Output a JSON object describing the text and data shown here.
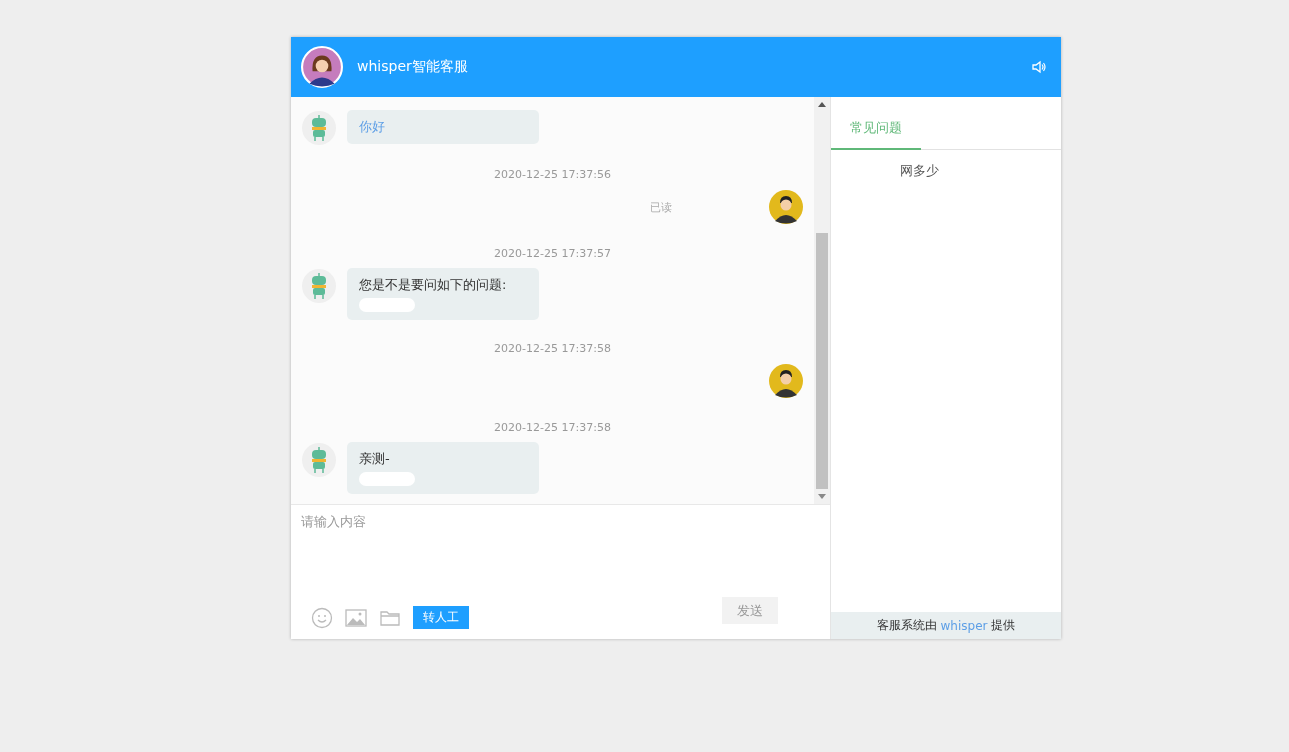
{
  "header": {
    "title": "whisper智能客服"
  },
  "messages": [
    {
      "kind": "bot",
      "text": "你好",
      "link": true
    },
    {
      "kind": "time",
      "text": "2020-12-25 17:37:56"
    },
    {
      "kind": "user",
      "status": "已读"
    },
    {
      "kind": "time",
      "text": "2020-12-25 17:37:57"
    },
    {
      "kind": "bot",
      "text": "您是不是要问如下的问题:",
      "link": false,
      "redacted": true
    },
    {
      "kind": "time",
      "text": "2020-12-25 17:37:58"
    },
    {
      "kind": "user"
    },
    {
      "kind": "time",
      "text": "2020-12-25 17:37:58"
    },
    {
      "kind": "bot",
      "text": "亲测-",
      "link": false,
      "redacted": true
    }
  ],
  "input": {
    "placeholder": "请输入内容"
  },
  "transfer_button": "转人工",
  "send_button": {
    "label": "发送",
    "disabled": true
  },
  "side_tabs": [
    {
      "label": "常见问题",
      "selected": true
    }
  ],
  "faq": [
    "网多少"
  ],
  "footer": {
    "before": "客服系统由",
    "link": "whisper",
    "after": "提供"
  }
}
